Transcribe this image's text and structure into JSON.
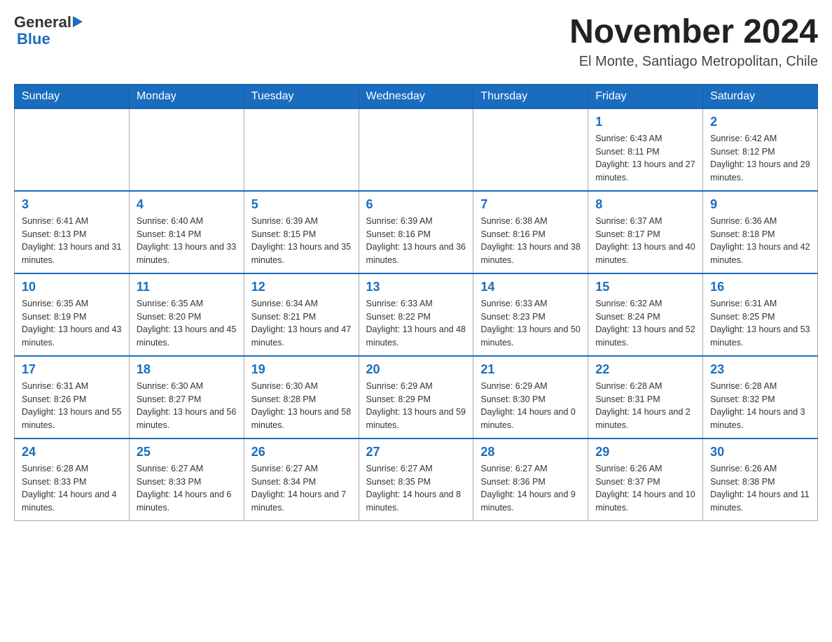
{
  "header": {
    "logo": {
      "general": "General",
      "blue": "Blue"
    },
    "title": "November 2024",
    "location": "El Monte, Santiago Metropolitan, Chile"
  },
  "weekdays": [
    "Sunday",
    "Monday",
    "Tuesday",
    "Wednesday",
    "Thursday",
    "Friday",
    "Saturday"
  ],
  "weeks": [
    [
      {
        "day": "",
        "info": ""
      },
      {
        "day": "",
        "info": ""
      },
      {
        "day": "",
        "info": ""
      },
      {
        "day": "",
        "info": ""
      },
      {
        "day": "",
        "info": ""
      },
      {
        "day": "1",
        "info": "Sunrise: 6:43 AM\nSunset: 8:11 PM\nDaylight: 13 hours and 27 minutes."
      },
      {
        "day": "2",
        "info": "Sunrise: 6:42 AM\nSunset: 8:12 PM\nDaylight: 13 hours and 29 minutes."
      }
    ],
    [
      {
        "day": "3",
        "info": "Sunrise: 6:41 AM\nSunset: 8:13 PM\nDaylight: 13 hours and 31 minutes."
      },
      {
        "day": "4",
        "info": "Sunrise: 6:40 AM\nSunset: 8:14 PM\nDaylight: 13 hours and 33 minutes."
      },
      {
        "day": "5",
        "info": "Sunrise: 6:39 AM\nSunset: 8:15 PM\nDaylight: 13 hours and 35 minutes."
      },
      {
        "day": "6",
        "info": "Sunrise: 6:39 AM\nSunset: 8:16 PM\nDaylight: 13 hours and 36 minutes."
      },
      {
        "day": "7",
        "info": "Sunrise: 6:38 AM\nSunset: 8:16 PM\nDaylight: 13 hours and 38 minutes."
      },
      {
        "day": "8",
        "info": "Sunrise: 6:37 AM\nSunset: 8:17 PM\nDaylight: 13 hours and 40 minutes."
      },
      {
        "day": "9",
        "info": "Sunrise: 6:36 AM\nSunset: 8:18 PM\nDaylight: 13 hours and 42 minutes."
      }
    ],
    [
      {
        "day": "10",
        "info": "Sunrise: 6:35 AM\nSunset: 8:19 PM\nDaylight: 13 hours and 43 minutes."
      },
      {
        "day": "11",
        "info": "Sunrise: 6:35 AM\nSunset: 8:20 PM\nDaylight: 13 hours and 45 minutes."
      },
      {
        "day": "12",
        "info": "Sunrise: 6:34 AM\nSunset: 8:21 PM\nDaylight: 13 hours and 47 minutes."
      },
      {
        "day": "13",
        "info": "Sunrise: 6:33 AM\nSunset: 8:22 PM\nDaylight: 13 hours and 48 minutes."
      },
      {
        "day": "14",
        "info": "Sunrise: 6:33 AM\nSunset: 8:23 PM\nDaylight: 13 hours and 50 minutes."
      },
      {
        "day": "15",
        "info": "Sunrise: 6:32 AM\nSunset: 8:24 PM\nDaylight: 13 hours and 52 minutes."
      },
      {
        "day": "16",
        "info": "Sunrise: 6:31 AM\nSunset: 8:25 PM\nDaylight: 13 hours and 53 minutes."
      }
    ],
    [
      {
        "day": "17",
        "info": "Sunrise: 6:31 AM\nSunset: 8:26 PM\nDaylight: 13 hours and 55 minutes."
      },
      {
        "day": "18",
        "info": "Sunrise: 6:30 AM\nSunset: 8:27 PM\nDaylight: 13 hours and 56 minutes."
      },
      {
        "day": "19",
        "info": "Sunrise: 6:30 AM\nSunset: 8:28 PM\nDaylight: 13 hours and 58 minutes."
      },
      {
        "day": "20",
        "info": "Sunrise: 6:29 AM\nSunset: 8:29 PM\nDaylight: 13 hours and 59 minutes."
      },
      {
        "day": "21",
        "info": "Sunrise: 6:29 AM\nSunset: 8:30 PM\nDaylight: 14 hours and 0 minutes."
      },
      {
        "day": "22",
        "info": "Sunrise: 6:28 AM\nSunset: 8:31 PM\nDaylight: 14 hours and 2 minutes."
      },
      {
        "day": "23",
        "info": "Sunrise: 6:28 AM\nSunset: 8:32 PM\nDaylight: 14 hours and 3 minutes."
      }
    ],
    [
      {
        "day": "24",
        "info": "Sunrise: 6:28 AM\nSunset: 8:33 PM\nDaylight: 14 hours and 4 minutes."
      },
      {
        "day": "25",
        "info": "Sunrise: 6:27 AM\nSunset: 8:33 PM\nDaylight: 14 hours and 6 minutes."
      },
      {
        "day": "26",
        "info": "Sunrise: 6:27 AM\nSunset: 8:34 PM\nDaylight: 14 hours and 7 minutes."
      },
      {
        "day": "27",
        "info": "Sunrise: 6:27 AM\nSunset: 8:35 PM\nDaylight: 14 hours and 8 minutes."
      },
      {
        "day": "28",
        "info": "Sunrise: 6:27 AM\nSunset: 8:36 PM\nDaylight: 14 hours and 9 minutes."
      },
      {
        "day": "29",
        "info": "Sunrise: 6:26 AM\nSunset: 8:37 PM\nDaylight: 14 hours and 10 minutes."
      },
      {
        "day": "30",
        "info": "Sunrise: 6:26 AM\nSunset: 8:38 PM\nDaylight: 14 hours and 11 minutes."
      }
    ]
  ]
}
